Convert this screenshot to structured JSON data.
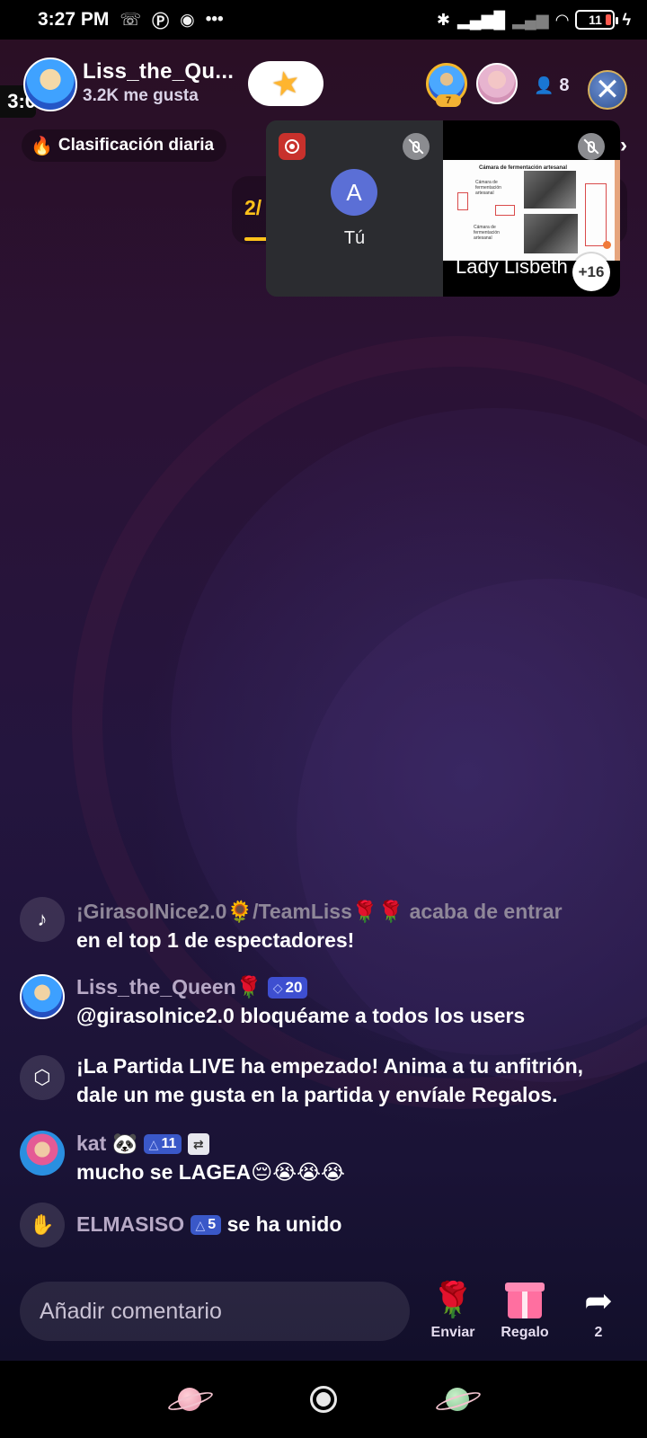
{
  "status_bar": {
    "time": "3:27 PM",
    "icons": [
      "missed-call-icon",
      "pinterest-icon",
      "radar-icon",
      "more-icon"
    ],
    "right_icons": [
      "bluetooth-icon",
      "signal-icon",
      "signal-off-icon",
      "wifi-icon"
    ],
    "battery": "11",
    "battery_color": "#ff5a4f"
  },
  "host": {
    "name": "Liss_the_Qu...",
    "likes": "3.2K me gusta",
    "timer": "3:0"
  },
  "top_viewers": {
    "rank_badge": "7",
    "count": "8"
  },
  "daily_ranking": {
    "label": "Clasificación diaria"
  },
  "match": {
    "score": "2/"
  },
  "call_panel": {
    "self": {
      "initial": "A",
      "name": "Tú"
    },
    "remote": {
      "name": "Lady Lisbeth",
      "extra_count": "+16",
      "slide_title": "Cámara de fermentación artesanal",
      "slide_label_1": "Cámara de fermentación artesanal",
      "slide_label_2": "Cámara de fermentación artesanal"
    }
  },
  "chat": [
    {
      "id": "sys-top",
      "user": "¡GirasolNice2.0🌻/TeamLiss🌹🌹",
      "text_1": "acaba de entrar",
      "text_2": "en el top 1 de espectadores!"
    },
    {
      "id": "host-msg",
      "user": "Liss_the_Queen🌹",
      "badge": "20",
      "text": "@girasolnice2.0 bloquéame a todos los users"
    },
    {
      "id": "game",
      "text": "¡La Partida LIVE ha empezado! Anima a tu anfitrión, dale un me gusta en la partida y envíale Regalos."
    },
    {
      "id": "kat",
      "user": "kat 🐼",
      "badge": "11",
      "text": "mucho se LAGEA😔😭😭😭"
    },
    {
      "id": "join",
      "user": "ELMASISO",
      "badge": "5",
      "text": "se ha unido"
    }
  ],
  "bottom_bar": {
    "comment_placeholder": "Añadir comentario",
    "send_label": "Enviar",
    "gift_label": "Regalo",
    "share_count": "2"
  },
  "colors": {
    "accent_yellow": "#ffc21a",
    "badge_blue": "#3e4fd0",
    "record_red": "#c8312c"
  }
}
